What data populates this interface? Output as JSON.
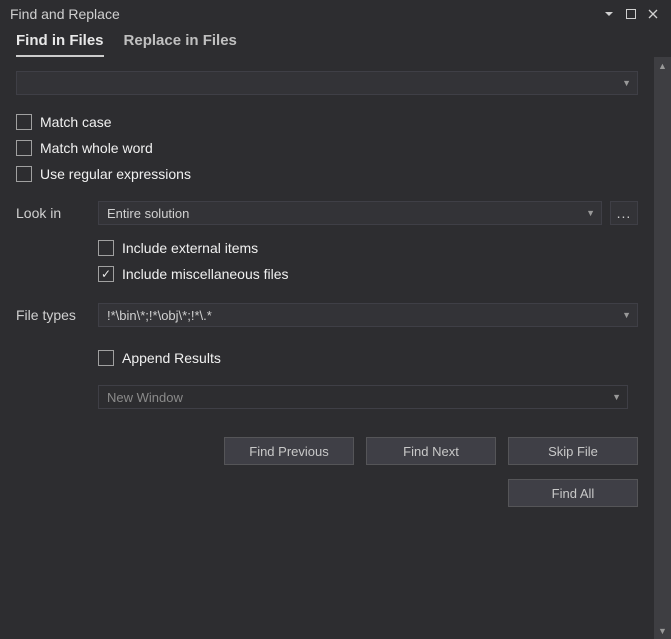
{
  "window": {
    "title": "Find and Replace"
  },
  "tabs": {
    "find": "Find in Files",
    "replace": "Replace in Files"
  },
  "search": {
    "value": ""
  },
  "options": {
    "match_case": "Match case",
    "match_whole_word": "Match whole word",
    "use_regex": "Use regular expressions"
  },
  "look_in": {
    "label": "Look in",
    "value": "Entire solution",
    "include_external": "Include external items",
    "include_misc": "Include miscellaneous files"
  },
  "file_types": {
    "label": "File types",
    "value": "!*\\bin\\*;!*\\obj\\*;!*\\.*"
  },
  "results": {
    "append": "Append Results",
    "window": "New Window"
  },
  "buttons": {
    "find_previous": "Find Previous",
    "find_next": "Find Next",
    "skip_file": "Skip File",
    "find_all": "Find All"
  },
  "icons": {
    "browse": "..."
  }
}
